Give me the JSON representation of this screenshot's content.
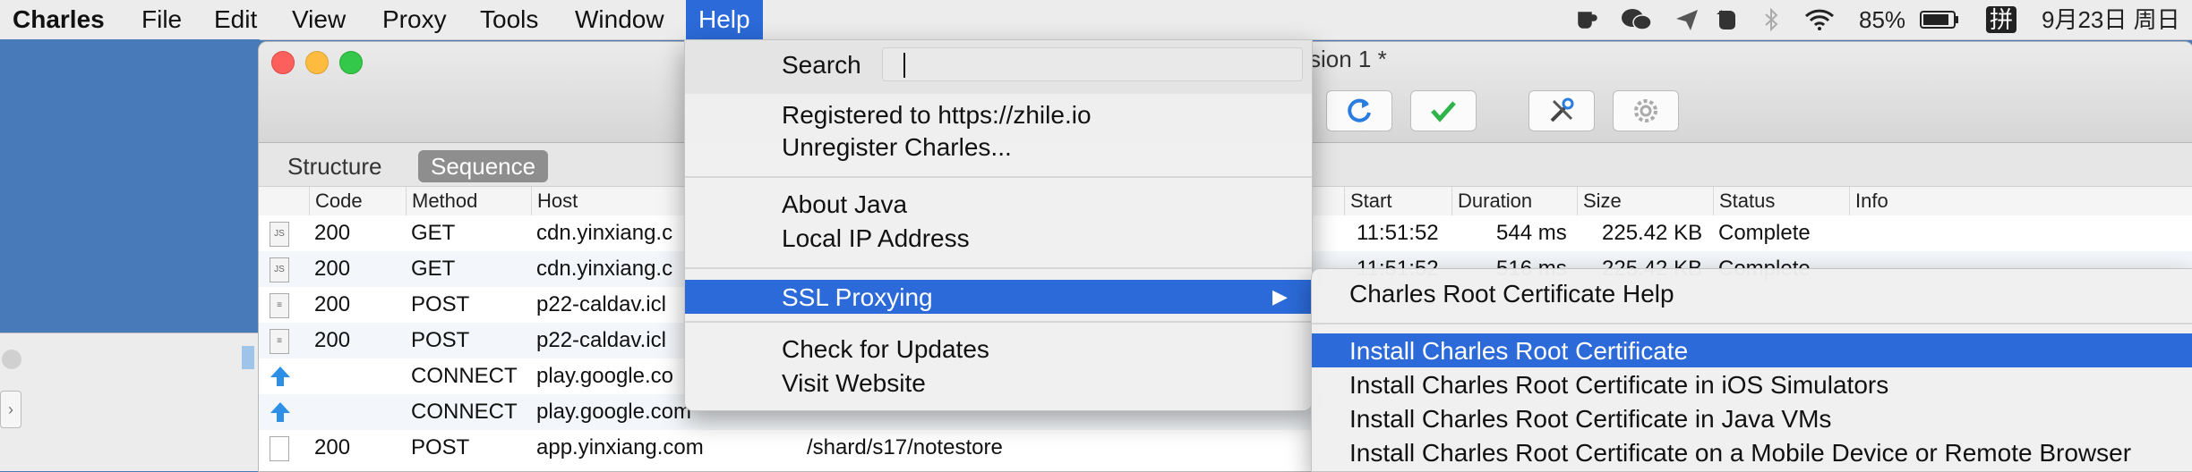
{
  "menubar": {
    "app_name": "Charles",
    "items": [
      "File",
      "Edit",
      "View",
      "Proxy",
      "Tools",
      "Window",
      "Help"
    ],
    "status": {
      "battery_percent": "85%",
      "input_method": "拼",
      "date": "9月23日 周日"
    },
    "icons": [
      "cup-icon",
      "wechat-icon",
      "send-icon",
      "evernote-icon",
      "bluetooth-icon",
      "wifi-icon",
      "battery-icon"
    ]
  },
  "window": {
    "title_fragment": "ssion 1 *",
    "toolbar": [
      "refresh-icon",
      "check-icon",
      "tools-icon",
      "settings-icon"
    ],
    "tabs": [
      "Structure",
      "Sequence"
    ],
    "active_tab": "Sequence",
    "columns": [
      "Code",
      "Method",
      "Host",
      "Start",
      "Duration",
      "Size",
      "Status",
      "Info"
    ],
    "rows": [
      {
        "icon": "js-file-icon",
        "code": "200",
        "method": "GET",
        "host": "cdn.yinxiang.c",
        "path": "",
        "start": "11:51:52",
        "duration": "544 ms",
        "size": "225.42 KB",
        "status": "Complete"
      },
      {
        "icon": "js-file-icon",
        "code": "200",
        "method": "GET",
        "host": "cdn.yinxiang.c",
        "path": "",
        "start": "11:51:52",
        "duration": "516 ms",
        "size": "225.42 KB",
        "status": "Complete"
      },
      {
        "icon": "doc-file-icon",
        "code": "200",
        "method": "POST",
        "host": "p22-caldav.icl",
        "path": "",
        "start": "",
        "duration": "",
        "size": "",
        "status": ""
      },
      {
        "icon": "doc-file-icon",
        "code": "200",
        "method": "POST",
        "host": "p22-caldav.icl",
        "path": "",
        "start": "",
        "duration": "",
        "size": "",
        "status": ""
      },
      {
        "icon": "upload-arrow-icon",
        "code": "",
        "method": "CONNECT",
        "host": "play.google.co",
        "path": "",
        "start": "",
        "duration": "",
        "size": "",
        "status": ""
      },
      {
        "icon": "upload-arrow-icon",
        "code": "",
        "method": "CONNECT",
        "host": "play.google.com",
        "path": "",
        "start": "",
        "duration": "",
        "size": "",
        "status": ""
      },
      {
        "icon": "blank-file-icon",
        "code": "200",
        "method": "POST",
        "host": "app.yinxiang.com",
        "path": "/shard/s17/notestore",
        "start": "",
        "duration": "",
        "size": "",
        "status": ""
      }
    ]
  },
  "help_menu": {
    "search_label": "Search",
    "search_value": "",
    "registered": "Registered to https://zhile.io",
    "unregister": "Unregister Charles...",
    "about_java": "About Java",
    "local_ip": "Local IP Address",
    "ssl_proxying": "SSL Proxying",
    "check_updates": "Check for Updates",
    "visit_website": "Visit Website"
  },
  "ssl_submenu": {
    "root_cert_help": "Charles Root Certificate Help",
    "install_root": "Install Charles Root Certificate",
    "install_ios": "Install Charles Root Certificate in iOS Simulators",
    "install_java": "Install Charles Root Certificate in Java VMs",
    "install_mobile": "Install Charles Root Certificate on a Mobile Device or Remote Browser"
  },
  "colors": {
    "highlight": "#2b6ad8",
    "desktop": "#4a7ab8"
  }
}
